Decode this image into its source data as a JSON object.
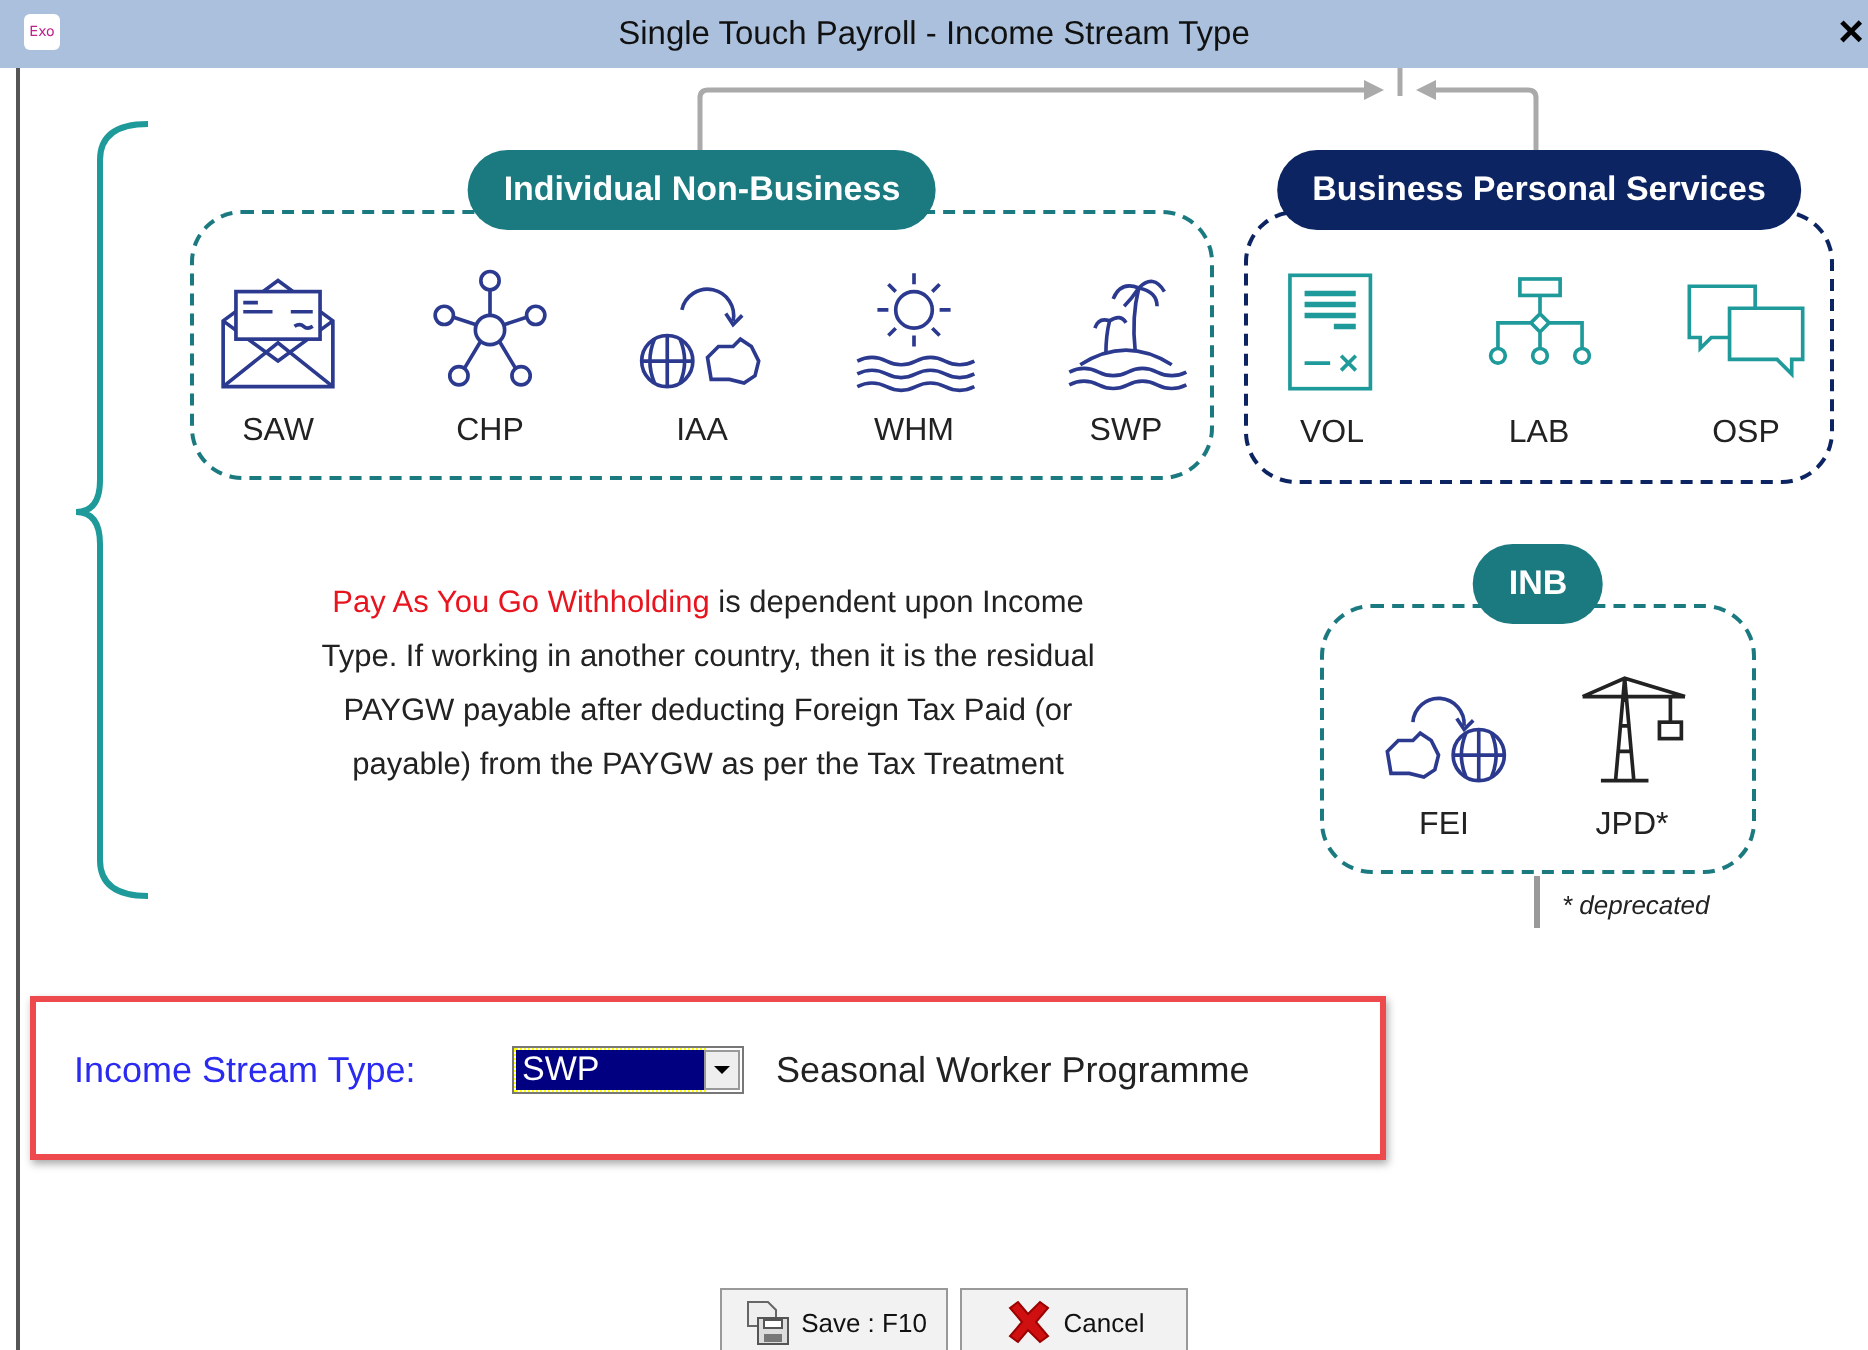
{
  "window": {
    "title": "Single Touch Payroll - Income Stream Type",
    "app_badge": "Exo",
    "close": "×"
  },
  "diagram": {
    "groups": [
      {
        "title": "Individual Non-Business",
        "color": "#1a7a80",
        "items": [
          "SAW",
          "CHP",
          "IAA",
          "WHM",
          "SWP"
        ]
      },
      {
        "title": "Business Personal Services",
        "color": "#0c2461",
        "items": [
          "VOL",
          "LAB",
          "OSP"
        ]
      },
      {
        "title": "INB",
        "color": "#1a7a80",
        "items": [
          "FEI",
          "JPD*"
        ]
      }
    ],
    "explanation": {
      "highlight": "Pay As You Go Withholding",
      "rest": "is dependent upon Income Type. If working in another country, then it is the residual PAYGW payable after deducting Foreign Tax Paid (or payable) from the PAYGW as per the Tax Treatment"
    },
    "note": "* deprecated"
  },
  "form": {
    "label": "Income Stream Type:",
    "select": {
      "value": "SWP",
      "focused": true
    },
    "description": "Seasonal Worker Programme"
  },
  "buttons": [
    {
      "kind": "save",
      "label": "Save : F10"
    },
    {
      "kind": "cancel",
      "label": "Cancel"
    }
  ]
}
